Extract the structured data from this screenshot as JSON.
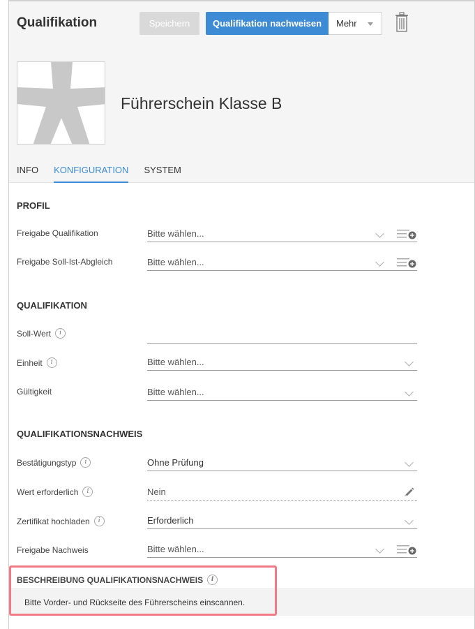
{
  "header": {
    "title": "Qualifikation",
    "save_label": "Speichern",
    "prove_label": "Qualifikation nachweisen",
    "more_label": "Mehr"
  },
  "entity": {
    "name": "Führerschein Klasse B"
  },
  "tabs": [
    {
      "label": "INFO",
      "active": false
    },
    {
      "label": "KONFIGURATION",
      "active": true
    },
    {
      "label": "SYSTEM",
      "active": false
    }
  ],
  "profil": {
    "heading": "PROFIL",
    "rows": [
      {
        "label": "Freigabe Qualifikation",
        "value": "Bitte wählen..."
      },
      {
        "label": "Freigabe Soll-Ist-Abgleich",
        "value": "Bitte wählen..."
      }
    ]
  },
  "qualifikation": {
    "heading": "QUALIFIKATION",
    "rows": [
      {
        "label": "Soll-Wert",
        "value": ""
      },
      {
        "label": "Einheit",
        "value": "Bitte wählen..."
      },
      {
        "label": "Gültigkeit",
        "value": "Bitte wählen..."
      }
    ]
  },
  "nachweis": {
    "heading": "QUALIFIKATIONSNACHWEIS",
    "rows": [
      {
        "label": "Bestätigungstyp",
        "value": "Ohne Prüfung"
      },
      {
        "label": "Wert erforderlich",
        "value": "Nein"
      },
      {
        "label": "Zertifikat hochladen",
        "value": "Erforderlich"
      },
      {
        "label": "Freigabe Nachweis",
        "value": "Bitte wählen..."
      }
    ]
  },
  "beschreibung": {
    "heading": "BESCHREIBUNG QUALIFIKATIONSNACHWEIS",
    "text": "Bitte Vorder- und Rückseite des Führerscheins einscannen."
  },
  "info_icon_glyph": "i",
  "colors": {
    "accent": "#3d8bd4",
    "save_disabled": "#d9d9d9",
    "highlight": "#f17a86",
    "avatar_shape": "#c8c8c8"
  }
}
